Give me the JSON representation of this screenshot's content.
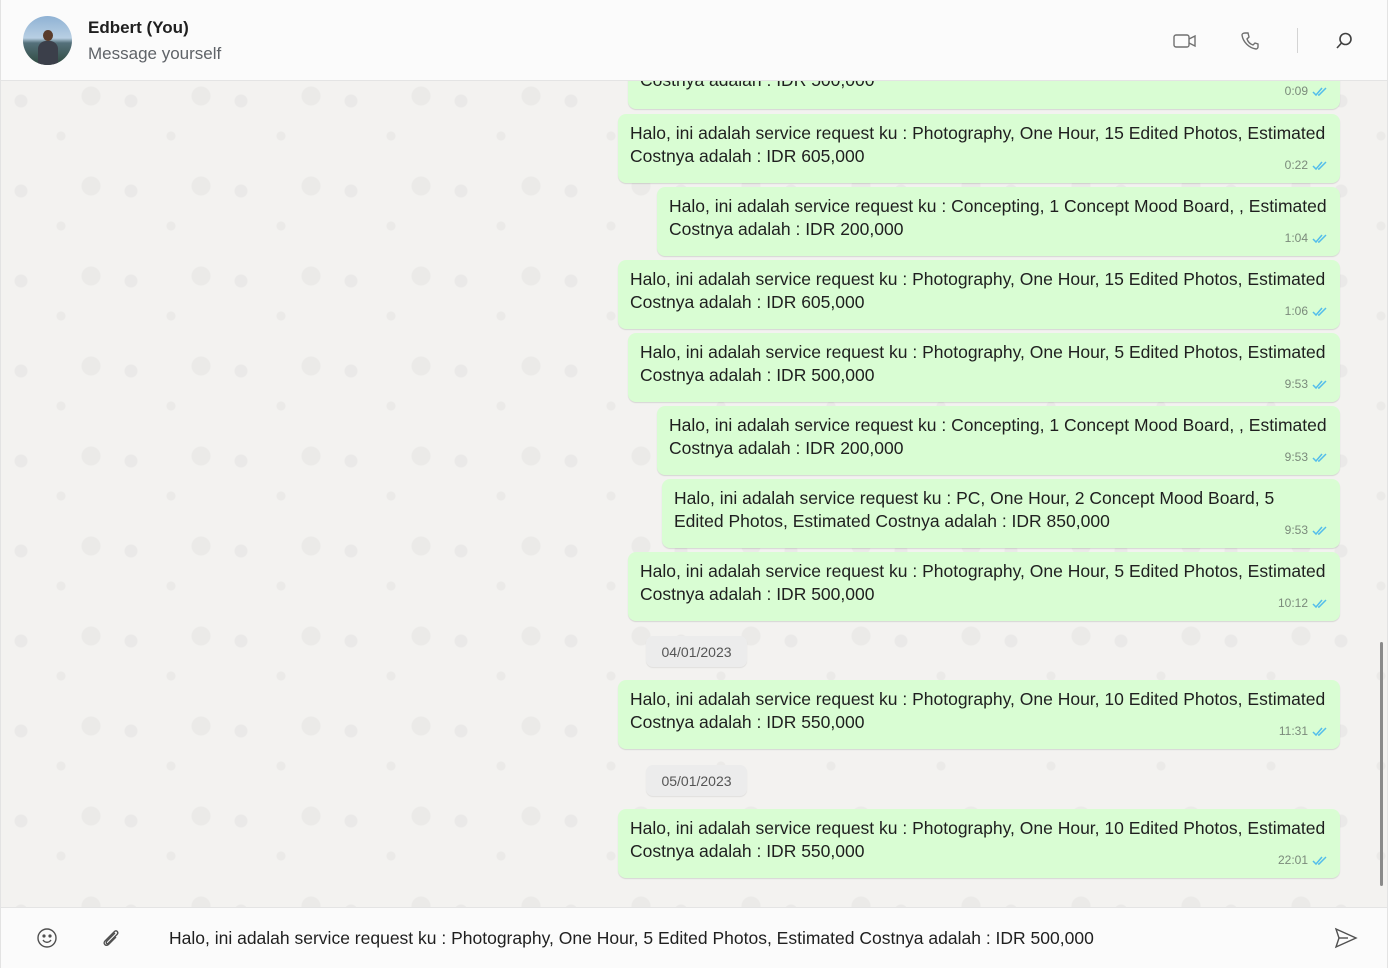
{
  "header": {
    "name": "Edbert (You)",
    "status": "Message yourself"
  },
  "messages": [
    {
      "text": "Costnya adalah : IDR 500,000",
      "time": "0:09"
    },
    {
      "text": "Halo, ini adalah service request ku : Photography, One Hour, 15 Edited Photos, Estimated Costnya adalah : IDR 605,000",
      "time": "0:22"
    },
    {
      "text": "Halo, ini adalah service request ku : Concepting, 1 Concept Mood Board, , Estimated Costnya adalah : IDR 200,000",
      "time": "1:04"
    },
    {
      "text": "Halo, ini adalah service request ku : Photography, One Hour, 15 Edited Photos, Estimated Costnya adalah : IDR 605,000",
      "time": "1:06"
    },
    {
      "text": "Halo, ini adalah service request ku : Photography, One Hour, 5 Edited Photos, Estimated Costnya adalah : IDR 500,000",
      "time": "9:53"
    },
    {
      "text": "Halo, ini adalah service request ku : Concepting, 1 Concept Mood Board, , Estimated Costnya adalah : IDR 200,000",
      "time": "9:53"
    },
    {
      "text": "Halo, ini adalah service request ku : PC, One Hour, 2 Concept Mood Board, 5 Edited Photos, Estimated Costnya adalah : IDR 850,000",
      "time": "9:53"
    },
    {
      "text": "Halo, ini adalah service request ku : Photography, One Hour, 5 Edited Photos, Estimated Costnya adalah : IDR 500,000",
      "time": "10:12"
    },
    {
      "text": "Halo, ini adalah service request ku : Photography, One Hour, 10 Edited Photos, Estimated Costnya adalah : IDR 550,000",
      "time": "11:31"
    },
    {
      "text": "Halo, ini adalah service request ku : Photography, One Hour, 10 Edited Photos, Estimated Costnya adalah : IDR 550,000",
      "time": "22:01"
    }
  ],
  "date_separators": [
    "04/01/2023",
    "05/01/2023"
  ],
  "composer": {
    "value": "Halo, ini adalah service request ku : Photography, One Hour, 5 Edited Photos, Estimated Costnya adalah : IDR 500,000"
  },
  "colors": {
    "bubble": "#d9fdd3",
    "tick": "#53bdeb",
    "chat_bg": "#f3f2f0"
  },
  "icons": {
    "video_call": "video-camera-icon",
    "voice_call": "phone-icon",
    "search": "search-icon",
    "emoji": "emoji-icon",
    "attach": "paperclip-icon",
    "send": "send-icon",
    "read_status": "double-check-icon"
  }
}
